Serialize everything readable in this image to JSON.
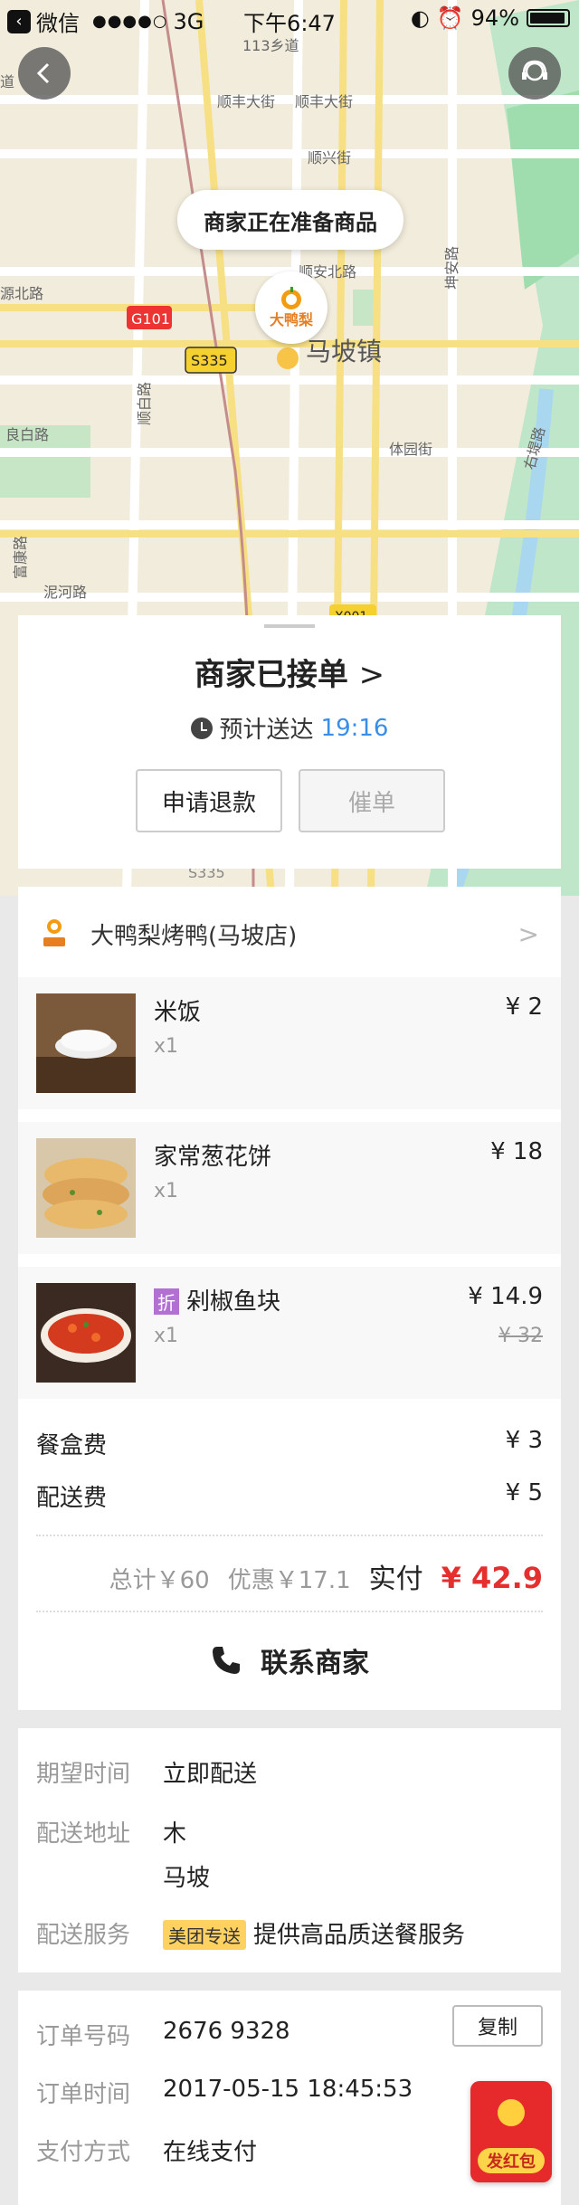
{
  "status_bar": {
    "app": "微信",
    "signal": "●●●●○",
    "network": "3G",
    "time": "下午6:47",
    "battery": "94%",
    "battery_level": 0.94
  },
  "map": {
    "bubble_text": "商家正在准备商品",
    "shop_marker_text": "大鸭梨",
    "labels": {
      "road_113": "113乡道",
      "shunfeng1": "顺丰大街",
      "shunfeng2": "顺丰大街",
      "shunxing": "顺兴街",
      "shunan": "顺安北路",
      "kunan": "坤安路",
      "yuanbei": "源北路",
      "liangbai": "良白路",
      "fukang": "富康路",
      "nihe": "泥河路",
      "shunbai": "顺白路",
      "town": "马坡镇",
      "tiyu": "体园街",
      "youdi": "右堤路",
      "g101": "G101",
      "s335": "S335",
      "s335b": "S335",
      "dao": "道",
      "road_x": "X001"
    }
  },
  "status_card": {
    "title": "商家已接单",
    "eta_label": "预计送达",
    "eta_time": "19:16",
    "refund_button": "申请退款",
    "urge_button": "催单"
  },
  "order": {
    "shop_name": "大鸭梨烤鸭(马坡店)",
    "items": [
      {
        "name": "米饭",
        "qty": "x1",
        "price": "¥ 2",
        "orig": ""
      },
      {
        "name": "家常葱花饼",
        "qty": "x1",
        "price": "¥ 18",
        "orig": ""
      },
      {
        "name": "剁椒鱼块",
        "qty": "x1",
        "price": "¥ 14.9",
        "orig": "¥ 32",
        "tag": "折"
      }
    ],
    "box_fee_label": "餐盒费",
    "box_fee": "¥ 3",
    "delivery_fee_label": "配送费",
    "delivery_fee": "¥ 5",
    "total": "总计￥60",
    "discount": "优惠￥17.1",
    "paid_label": "实付",
    "paid": "¥ 42.9",
    "contact": "联系商家"
  },
  "delivery": {
    "expect_label": "期望时间",
    "expect_value": "立即配送",
    "address_label": "配送地址",
    "address_line1": "木",
    "address_line2": "马坡",
    "service_label": "配送服务",
    "service_tag": "美团专送",
    "service_value": "提供高品质送餐服务"
  },
  "order_info": {
    "number_label": "订单号码",
    "number_value": "2676 9328",
    "copy_button": "复制",
    "time_label": "订单时间",
    "time_value": "2017-05-15 18:45:53",
    "pay_label": "支付方式",
    "pay_value": "在线支付"
  },
  "red_packet": {
    "label": "发红包"
  },
  "colors": {
    "accent_blue": "#3a8ee6",
    "price_red": "#e52e2e",
    "tag_purple": "#b270d3",
    "tag_yellow": "#ffd161"
  }
}
